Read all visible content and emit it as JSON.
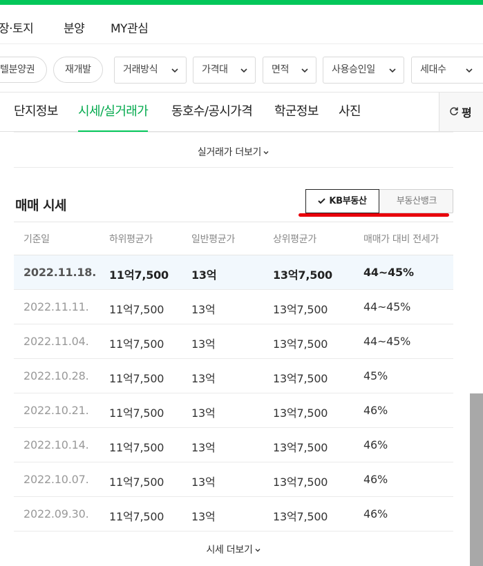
{
  "gnb": {
    "items": [
      "장·토지",
      "분양",
      "MY관심"
    ]
  },
  "filters": {
    "chips": [
      "텔분양권",
      "재개발"
    ],
    "dropdowns": [
      "거래방식",
      "가격대",
      "면적",
      "사용승인일",
      "세대수"
    ]
  },
  "tabs": [
    "단지정보",
    "시세/실거래가",
    "동호수/공시가격",
    "학군정보",
    "사진"
  ],
  "active_tab": "시세/실거래가",
  "refresh_label": "평",
  "realtrade_more": "실거래가 더보기",
  "price_section": {
    "title": "매매 시세",
    "source_active": "KB부동산",
    "source_other": "부동산뱅크",
    "columns": [
      "기준일",
      "하위평균가",
      "일반평균가",
      "상위평균가",
      "매매가 대비 전세가"
    ],
    "rows": [
      [
        "2022.11.18.",
        "11억7,500",
        "13억",
        "13억7,500",
        "44~45%"
      ],
      [
        "2022.11.11.",
        "11억7,500",
        "13억",
        "13억7,500",
        "44~45%"
      ],
      [
        "2022.11.04.",
        "11억7,500",
        "13억",
        "13억7,500",
        "44~45%"
      ],
      [
        "2022.10.28.",
        "11억7,500",
        "13억",
        "13억7,500",
        "45%"
      ],
      [
        "2022.10.21.",
        "11억7,500",
        "13억",
        "13억7,500",
        "46%"
      ],
      [
        "2022.10.14.",
        "11억7,500",
        "13억",
        "13억7,500",
        "46%"
      ],
      [
        "2022.10.07.",
        "11억7,500",
        "13억",
        "13억7,500",
        "46%"
      ],
      [
        "2022.09.30.",
        "11억7,500",
        "13억",
        "13억7,500",
        "46%"
      ]
    ],
    "more_label": "시세 더보기"
  },
  "colors": {
    "accent": "#03c75a",
    "highlight_mark": "#e8000b",
    "row_highlight": "#f2f8fd"
  }
}
